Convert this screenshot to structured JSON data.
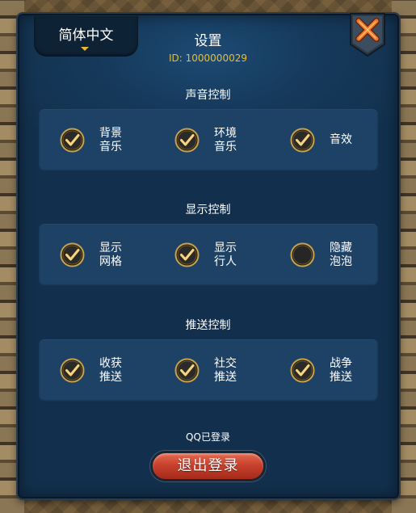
{
  "language_tab": {
    "label": "简体中文"
  },
  "header": {
    "title": "设置",
    "player_id": "ID: 1000000029"
  },
  "sections": [
    {
      "title": "声音控制",
      "options": [
        {
          "label": "背景\n音乐",
          "checked": true
        },
        {
          "label": "环境\n音乐",
          "checked": true
        },
        {
          "label": "音效",
          "checked": true
        }
      ]
    },
    {
      "title": "显示控制",
      "options": [
        {
          "label": "显示\n网格",
          "checked": true
        },
        {
          "label": "显示\n行人",
          "checked": true
        },
        {
          "label": "隐藏\n泡泡",
          "checked": false
        }
      ]
    },
    {
      "title": "推送控制",
      "options": [
        {
          "label": "收获\n推送",
          "checked": true
        },
        {
          "label": "社交\n推送",
          "checked": true
        },
        {
          "label": "战争\n推送",
          "checked": true
        }
      ]
    }
  ],
  "footer": {
    "login_status": "QQ已登录",
    "logout_label": "退出登录"
  },
  "colors": {
    "accent_gold": "#e6bf3a",
    "panel_blue": "#163a5c",
    "logout_red": "#c8412d"
  },
  "icons": {
    "close": "close-x-icon",
    "checked": "checkmark-icon",
    "unchecked": "empty-circle-icon"
  }
}
